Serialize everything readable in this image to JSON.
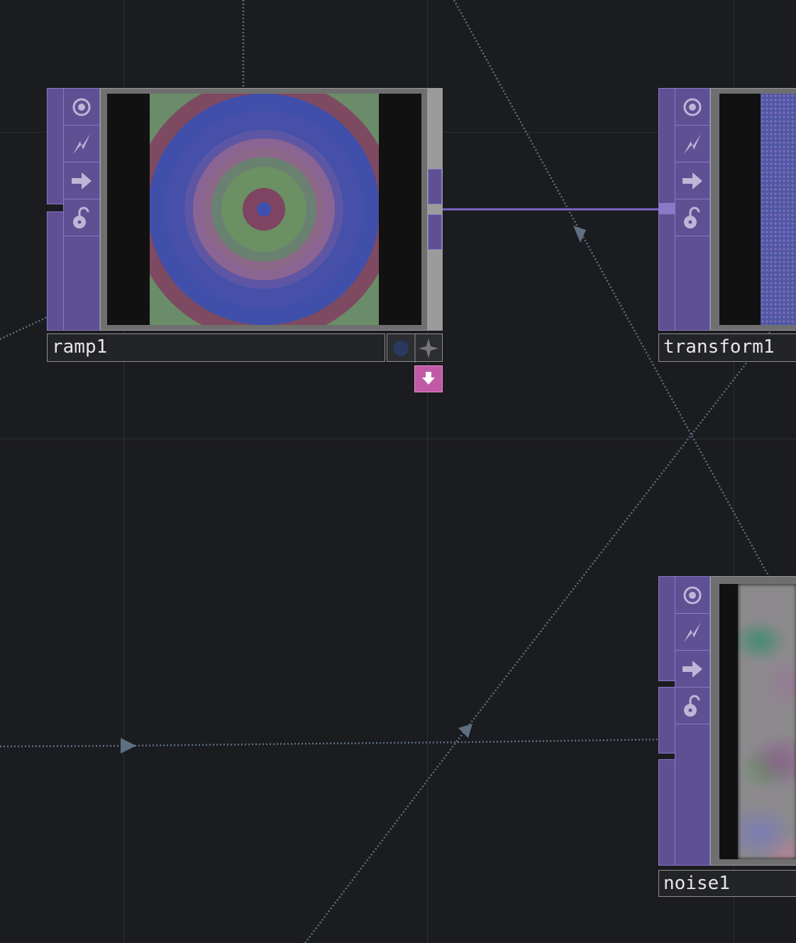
{
  "nodes": {
    "ramp1": {
      "name": "ramp1"
    },
    "transform1": {
      "name": "transform1"
    },
    "noise1": {
      "name": "noise1"
    }
  },
  "toolbar_icons": [
    "viewer-active-icon",
    "bypass-icon",
    "export-arrow-icon",
    "lock-open-icon"
  ],
  "colors": {
    "background": "#1b1c20",
    "node_purple": "#5f4f93",
    "node_border": "#8a79c6",
    "wire_dotted": "#5d6f80",
    "wire_solid": "#7d68c6",
    "pink_button": "#c05aa6"
  }
}
